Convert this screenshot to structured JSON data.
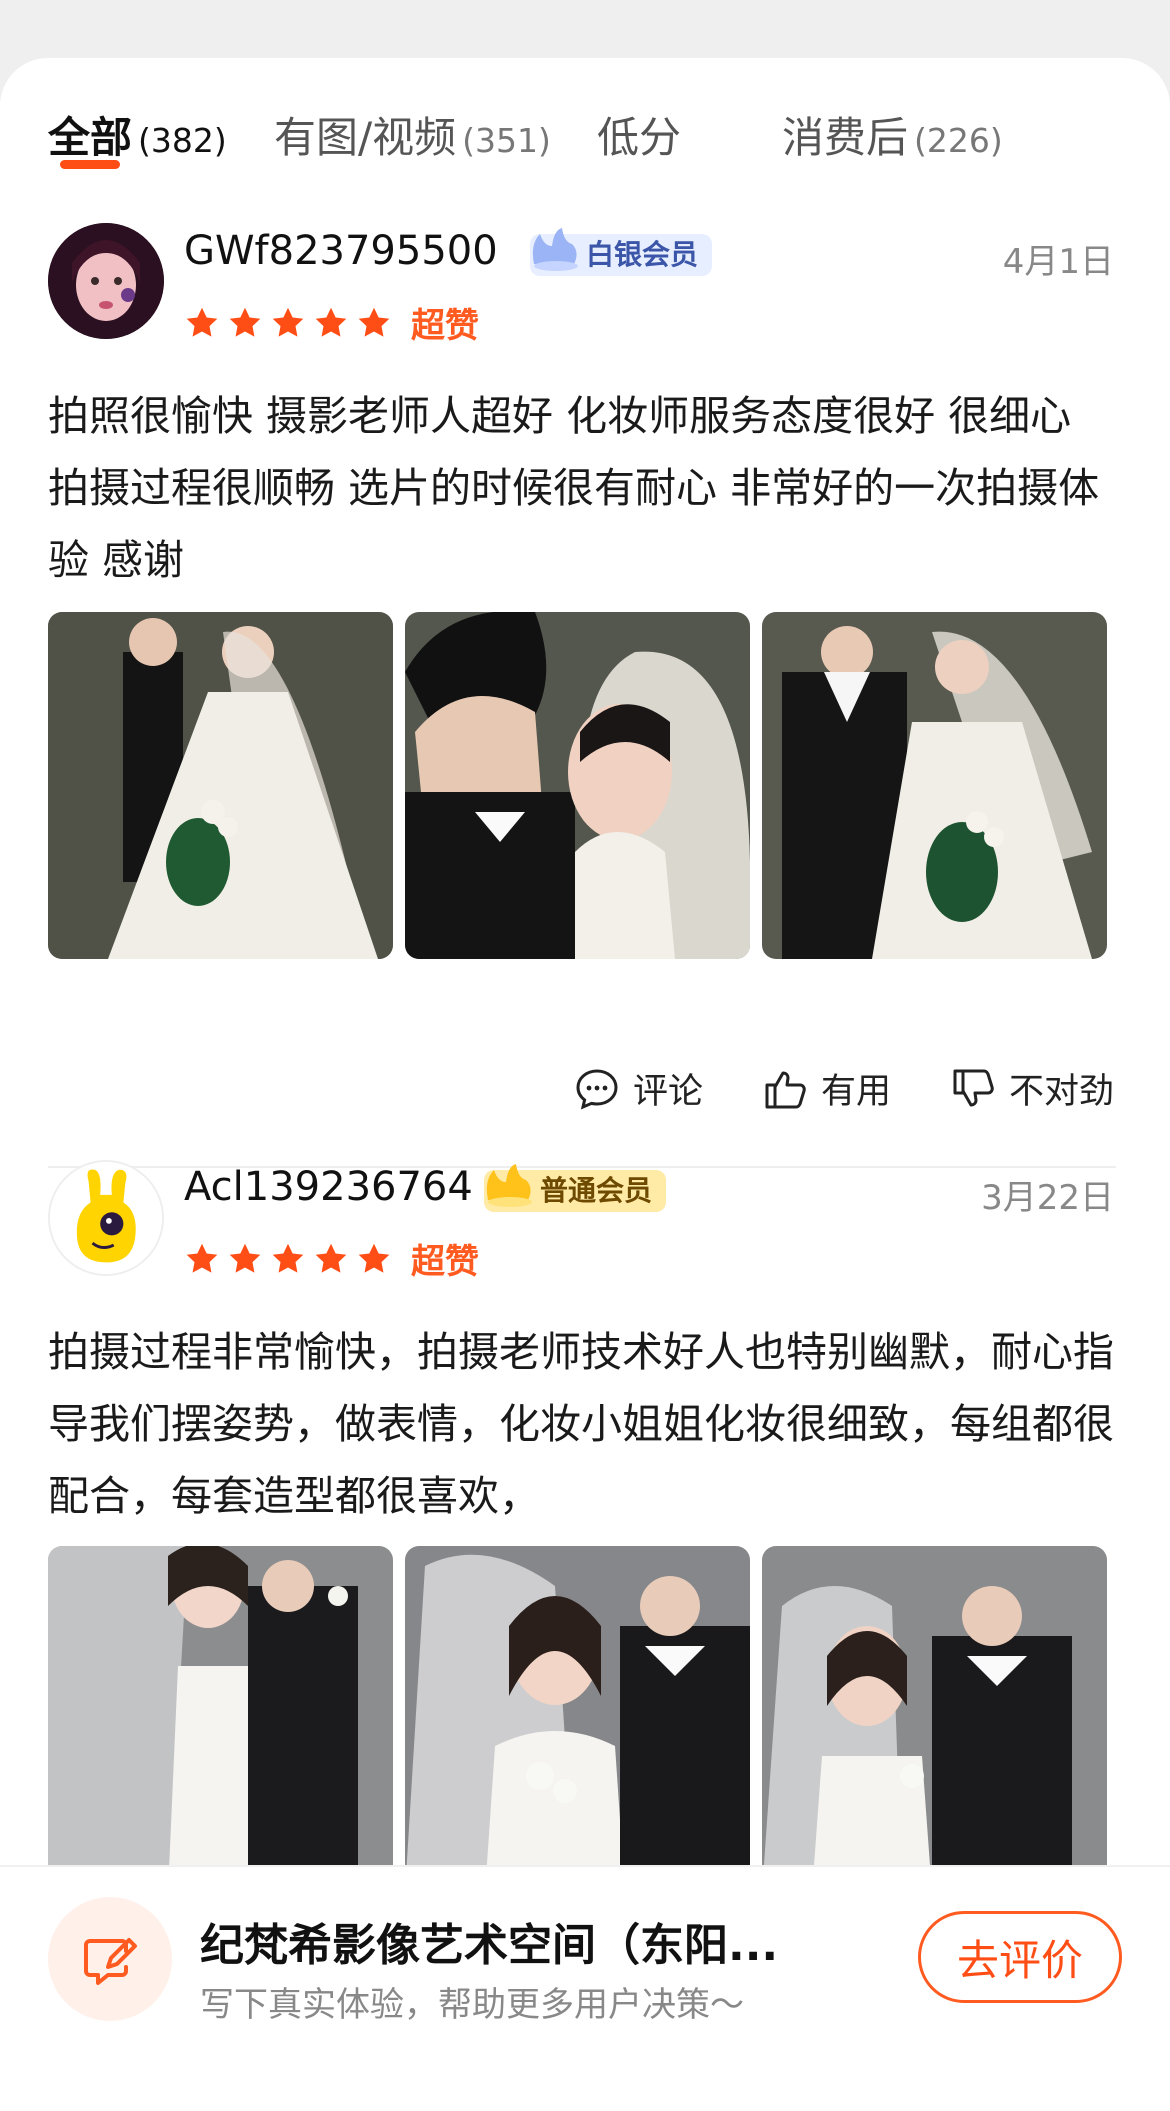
{
  "tabs": [
    {
      "label": "全部",
      "count": "(382)"
    },
    {
      "label": "有图/视频",
      "count": "(351)"
    },
    {
      "label": "低分",
      "count": ""
    },
    {
      "label": "消费后",
      "count": "(226)"
    }
  ],
  "reviews": [
    {
      "username": "GWf823795500",
      "badge": "白银会员",
      "date": "4月1日",
      "rating_stars": 5,
      "rating_word": "超赞",
      "content": "拍照很愉快 摄影老师人超好 化妆师服务态度很好 很细心 拍摄过程很顺畅 选片的时候很有耐心 非常好的一次拍摄体验 感谢"
    },
    {
      "username": "Acl139236764",
      "badge": "普通会员",
      "date": "3月22日",
      "rating_stars": 5,
      "rating_word": "超赞",
      "content": "拍摄过程非常愉快，拍摄老师技术好人也特别幽默，耐心指导我们摆姿势，做表情，化妆小姐姐化妆很细致，每组都很配合，每套造型都很喜欢，"
    }
  ],
  "actions": {
    "comment": "评论",
    "useful": "有用",
    "wrong": "不对劲"
  },
  "bottom_bar": {
    "title": "纪梵希影像艺术空间（东阳...",
    "subtitle": "写下真实体验，帮助更多用户决策～",
    "button": "去评价"
  },
  "colors": {
    "accent": "#ff5a1f",
    "star": "#ff4d16",
    "silver_badge_bg": "#e7eeff",
    "normal_badge_bg": "#ffeaa6"
  }
}
